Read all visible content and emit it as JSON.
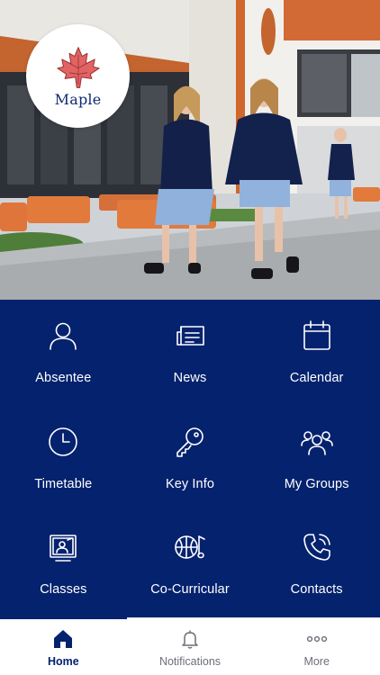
{
  "brand": {
    "name": "Maple",
    "primary_color": "#05226e",
    "logo_color": "#e06464"
  },
  "hero": {
    "image": "school-students-photo"
  },
  "tiles": [
    {
      "label": "Absentee",
      "icon": "person-icon"
    },
    {
      "label": "News",
      "icon": "newspaper-icon"
    },
    {
      "label": "Calendar",
      "icon": "calendar-icon"
    },
    {
      "label": "Timetable",
      "icon": "clock-icon"
    },
    {
      "label": "Key Info",
      "icon": "key-icon"
    },
    {
      "label": "My Groups",
      "icon": "group-icon"
    },
    {
      "label": "Classes",
      "icon": "classroom-icon"
    },
    {
      "label": "Co-Curricular",
      "icon": "sports-ball-icon"
    },
    {
      "label": "Contacts",
      "icon": "phone-icon"
    }
  ],
  "tabbar": {
    "active": "Home",
    "tabs": [
      {
        "label": "Home",
        "icon": "home-icon"
      },
      {
        "label": "Notifications",
        "icon": "bell-icon"
      },
      {
        "label": "More",
        "icon": "more-dots-icon"
      }
    ]
  }
}
